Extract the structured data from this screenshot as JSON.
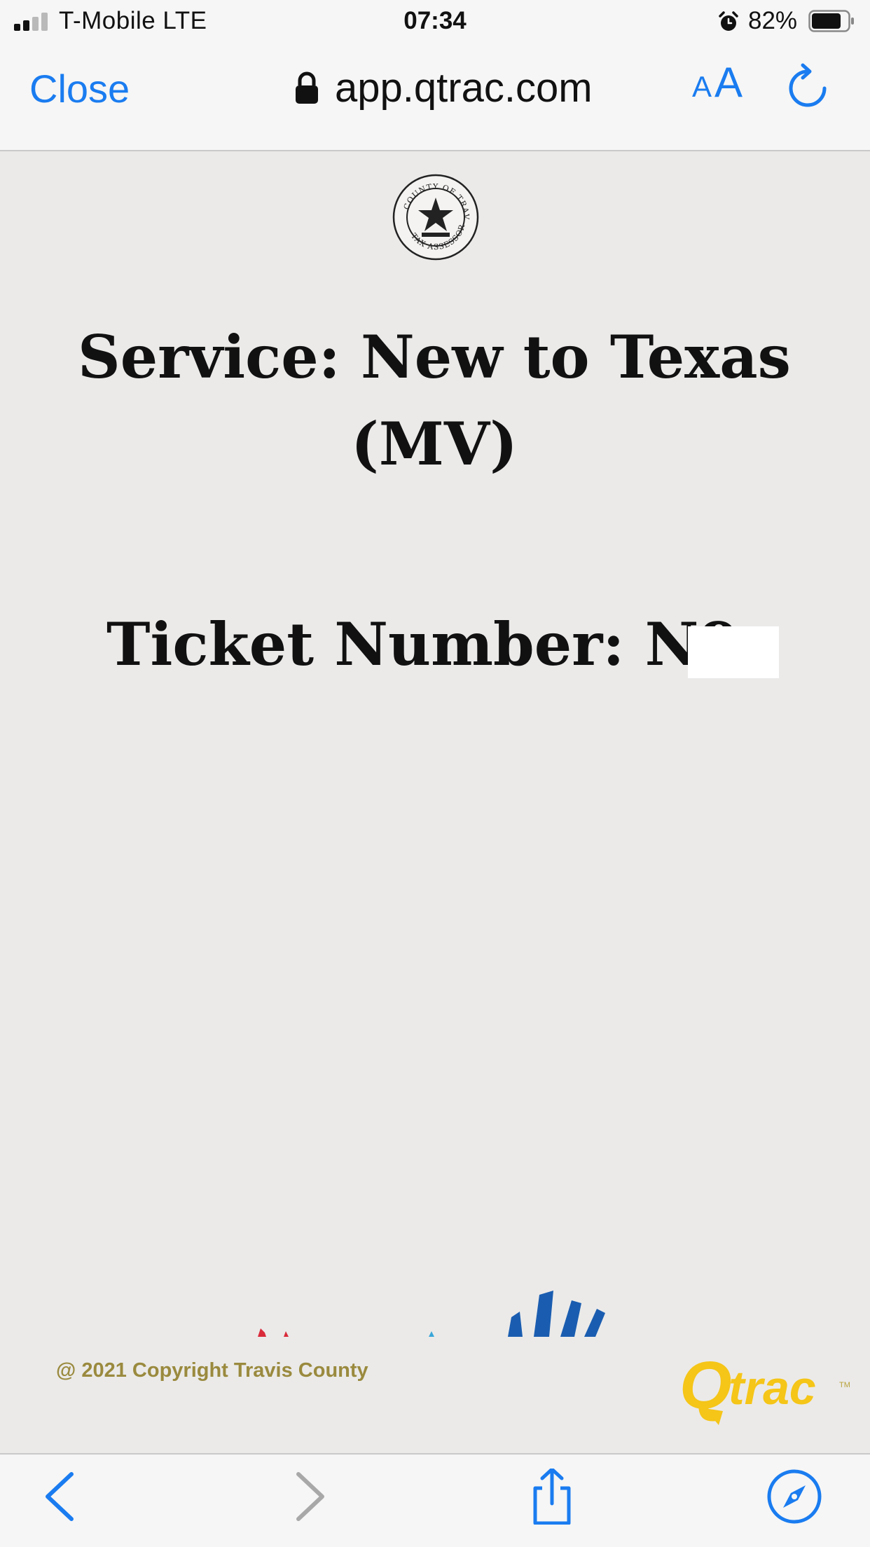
{
  "status_bar": {
    "carrier": "T-Mobile  LTE",
    "time": "07:34",
    "battery_percent": "82%",
    "battery_level": 0.82
  },
  "browser": {
    "close_label": "Close",
    "url": "app.qtrac.com",
    "text_size_small": "A",
    "text_size_large": "A"
  },
  "page": {
    "service_title": "Service: New to Texas (MV)",
    "ticket_label": "Ticket Number: N9",
    "copyright": "@ 2021 Copyright Travis County",
    "seal_text": "COUNTY OF TRAVIS · TAX ASSESSOR",
    "logo_text": "Qtrac"
  },
  "colors": {
    "accent": "#1a7cf0",
    "page_background": "#ebeae9",
    "copyright_gold": "#9a8a3e",
    "logo_yellow": "#f5c518"
  },
  "icons": {
    "lock": "lock-icon",
    "reload": "reload-icon",
    "back": "chevron-left-icon",
    "forward": "chevron-right-icon",
    "share": "share-icon",
    "browser": "compass-icon"
  }
}
